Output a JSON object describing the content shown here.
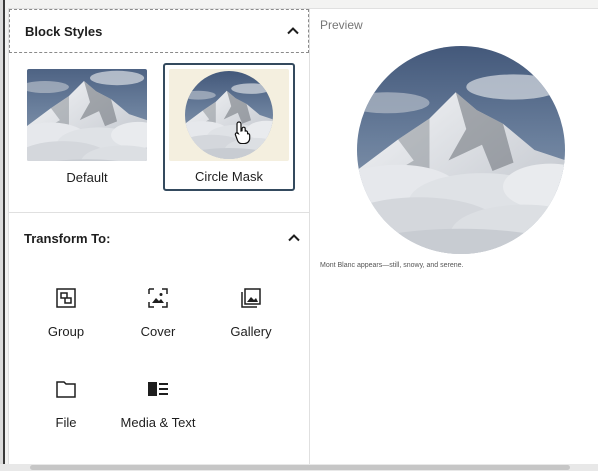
{
  "block_styles": {
    "title": "Block Styles",
    "options": [
      {
        "label": "Default",
        "selected": false
      },
      {
        "label": "Circle Mask",
        "selected": true
      }
    ]
  },
  "transform": {
    "title": "Transform To:",
    "items": [
      {
        "label": "Group",
        "icon": "group-icon"
      },
      {
        "label": "Cover",
        "icon": "cover-icon"
      },
      {
        "label": "Gallery",
        "icon": "gallery-icon"
      },
      {
        "label": "File",
        "icon": "file-icon"
      },
      {
        "label": "Media & Text",
        "icon": "media-text-icon"
      }
    ]
  },
  "preview": {
    "label": "Preview",
    "caption": "Mont Blanc appears—still, snowy, and serene."
  },
  "colors": {
    "selected_border": "#344a5e",
    "circle_mask_bg": "#f4efdf",
    "sky": "#5a6f8f"
  }
}
